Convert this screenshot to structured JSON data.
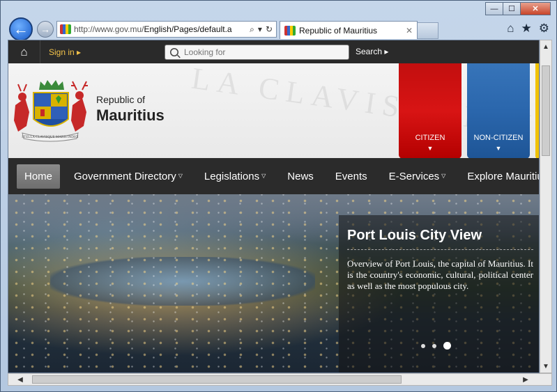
{
  "browser": {
    "address_url_prefix": "http://www.gov.mu/",
    "address_url_rest": "English/Pages/default.a",
    "tab_title": "Republic of Mauritius",
    "tab_close": "✕",
    "window_minimize": "—",
    "window_maximize": "☐",
    "window_close": "✕",
    "back_glyph": "←",
    "forward_glyph": "→",
    "search_glyph": "⌕",
    "dropdown_glyph": "▾",
    "refresh_glyph": "↻",
    "home_glyph": "⌂",
    "favorites_glyph": "★",
    "tools_glyph": "⚙"
  },
  "site": {
    "topbar": {
      "home_glyph": "⌂",
      "signin_label": "Sign in",
      "search_placeholder": "Looking for",
      "search_button": "Search"
    },
    "brand": {
      "line1": "Republic of",
      "line2": "Mauritius"
    },
    "watermark": "LA CLAVISQUE MARIS",
    "audience_cards": [
      {
        "label": "CITIZEN",
        "color": "#c80f0f"
      },
      {
        "label": "NON-CITIZEN",
        "color": "#2a66ac"
      }
    ],
    "nav": [
      {
        "label": "Home",
        "active": true,
        "dropdown": false
      },
      {
        "label": "Government Directory",
        "active": false,
        "dropdown": true
      },
      {
        "label": "Legislations",
        "active": false,
        "dropdown": true
      },
      {
        "label": "News",
        "active": false,
        "dropdown": false
      },
      {
        "label": "Events",
        "active": false,
        "dropdown": false
      },
      {
        "label": "E-Services",
        "active": false,
        "dropdown": true
      },
      {
        "label": "Explore Mauritius",
        "active": false,
        "dropdown": true
      }
    ],
    "hero": {
      "title": "Port Louis City View",
      "text": "Overview of Port Louis, the capital of Mauritius. It is the country's economic, cultural, political center as well as the most populous city.",
      "slides": 3,
      "active_slide": 3
    }
  },
  "colors": {
    "topbar": "#2a2a2a",
    "signin": "#f2c24a",
    "citizen_card": "#c80f0f",
    "noncitizen_card": "#2a66ac",
    "accent_strip": "#f1c200",
    "mainnav": "#2b2b2b"
  }
}
